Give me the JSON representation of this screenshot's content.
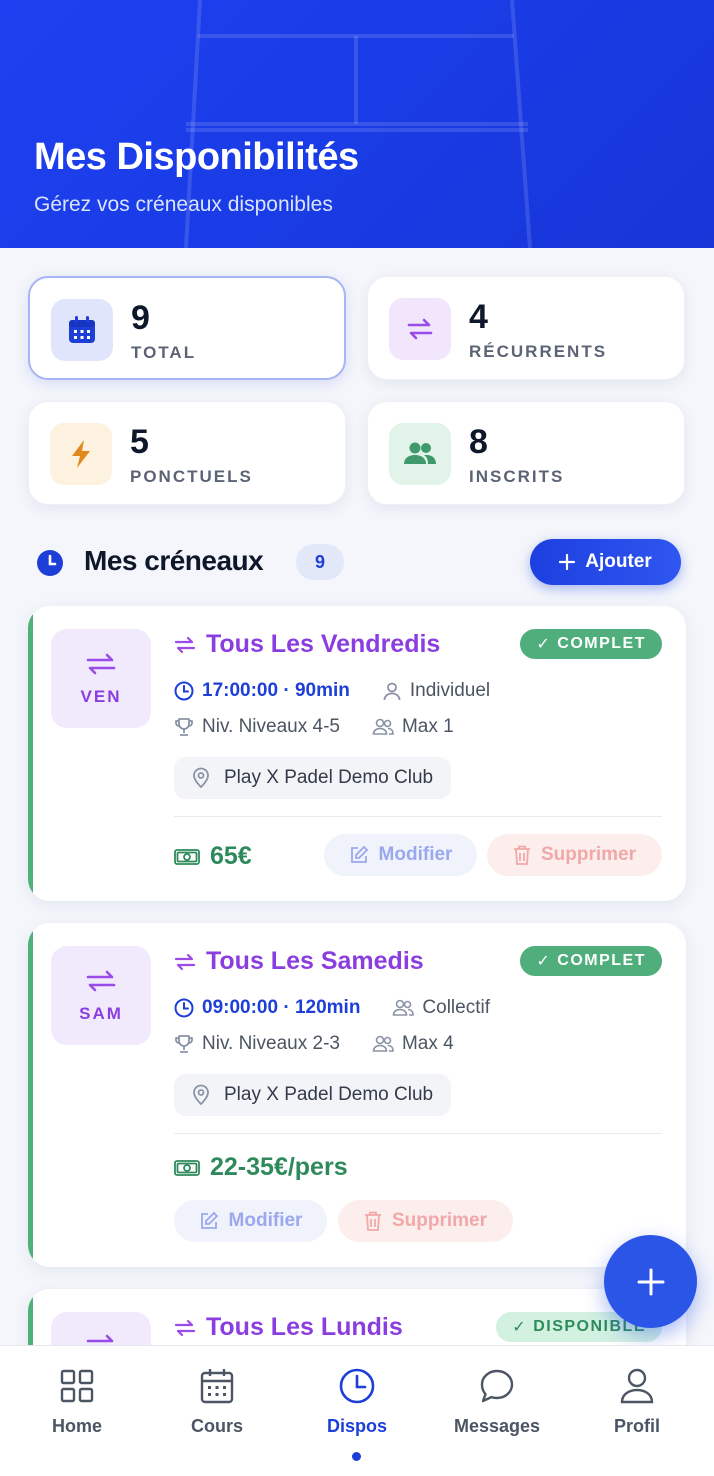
{
  "header": {
    "title": "Mes Disponibilités",
    "subtitle": "Gérez vos créneaux disponibles"
  },
  "stats": [
    {
      "value": "9",
      "label": "TOTAL",
      "icon": "calendar-icon",
      "color": "#1d3fd8"
    },
    {
      "value": "4",
      "label": "RÉCURRENTS",
      "icon": "repeat-icon",
      "color": "#9b4be8"
    },
    {
      "value": "5",
      "label": "PONCTUELS",
      "icon": "bolt-icon",
      "color": "#e08a1e"
    },
    {
      "value": "8",
      "label": "INSCRITS",
      "icon": "users-icon",
      "color": "#3e9a6a"
    }
  ],
  "section": {
    "title": "Mes créneaux",
    "count": "9",
    "add_label": "Ajouter"
  },
  "slots": [
    {
      "day": "VEN",
      "title": "Tous Les Vendredis",
      "status": "COMPLET",
      "time": "17:00:00 · 90min",
      "type": "Individuel",
      "level": "Niv. Niveaux 4-5",
      "max": "Max 1",
      "location": "Play X Padel Demo Club",
      "price": "65€",
      "edit_label": "Modifier",
      "delete_label": "Supprimer"
    },
    {
      "day": "SAM",
      "title": "Tous Les Samedis",
      "status": "COMPLET",
      "time": "09:00:00 · 120min",
      "type": "Collectif",
      "level": "Niv. Niveaux 2-3",
      "max": "Max 4",
      "location": "Play X Padel Demo Club",
      "price": "22-35€/pers",
      "edit_label": "Modifier",
      "delete_label": "Supprimer"
    },
    {
      "title": "Tous Les Lundis",
      "status": "DISPONIBLE"
    }
  ],
  "nav": [
    {
      "label": "Home",
      "icon": "grid-icon"
    },
    {
      "label": "Cours",
      "icon": "calendar-icon"
    },
    {
      "label": "Dispos",
      "icon": "clock-icon",
      "active": true
    },
    {
      "label": "Messages",
      "icon": "chat-icon"
    },
    {
      "label": "Profil",
      "icon": "user-icon"
    }
  ]
}
